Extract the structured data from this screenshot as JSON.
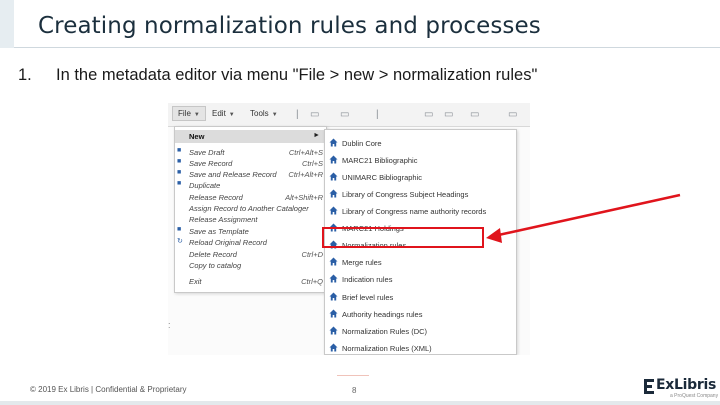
{
  "slide": {
    "title": "Creating normalization rules and processes",
    "step_number": "1.",
    "step_text": "In the metadata editor via menu \"File > new > normalization rules\""
  },
  "editor": {
    "menubar": [
      "File",
      "Edit",
      "Tools"
    ],
    "toolbar_icons": [
      "pipe-separator-icon",
      "document-icon",
      "document-icon",
      "pipe-separator-icon",
      "document-icon",
      "document-icon",
      "document-icon"
    ],
    "file_menu": [
      {
        "label": "New",
        "shortcut": "",
        "icon": "",
        "submenu": true,
        "highlight": true
      },
      {
        "label": "Save Draft",
        "shortcut": "Ctrl+Alt+S",
        "icon": "save-icon"
      },
      {
        "label": "Save Record",
        "shortcut": "Ctrl+S",
        "icon": "save-icon"
      },
      {
        "label": "Save and Release Record",
        "shortcut": "Ctrl+Alt+R",
        "icon": "save-icon"
      },
      {
        "label": "Duplicate",
        "shortcut": "",
        "icon": "save-icon"
      },
      {
        "label": "Release Record",
        "shortcut": "Alt+Shift+R",
        "icon": ""
      },
      {
        "label": "Assign Record to Another Cataloger",
        "shortcut": "",
        "icon": ""
      },
      {
        "label": "Release Assignment",
        "shortcut": "",
        "icon": ""
      },
      {
        "label": "Save as Template",
        "shortcut": "",
        "icon": "save-icon"
      },
      {
        "label": "Reload Original Record",
        "shortcut": "",
        "icon": "reload-icon"
      },
      {
        "label": "Delete Record",
        "shortcut": "Ctrl+D",
        "icon": ""
      },
      {
        "label": "Copy to catalog",
        "shortcut": "",
        "icon": ""
      },
      {
        "label": "Exit",
        "shortcut": "Ctrl+Q",
        "icon": ""
      }
    ],
    "new_submenu": [
      "Dublin Core",
      "MARC21 Bibliographic",
      "UNIMARC Bibliographic",
      "Library of Congress Subject Headings",
      "Library of Congress name authority records",
      "MARC21 Holdings",
      "Normalization rules",
      "Merge rules",
      "Indication rules",
      "Brief level rules",
      "Authority headings rules",
      "Normalization Rules (DC)",
      "Normalization Rules (XML)"
    ],
    "home_icon_color": "#2b5fa6"
  },
  "footer": {
    "copyright": "© 2019 Ex Libris | Confidential & Proprietary",
    "page_number": "8",
    "logo_text": "ExLibris",
    "logo_subtext": "a ProQuest Company"
  },
  "colors": {
    "title": "#1b2f3d",
    "highlight_box": "#e0141c",
    "accent_blue": "#2b5fa6"
  }
}
